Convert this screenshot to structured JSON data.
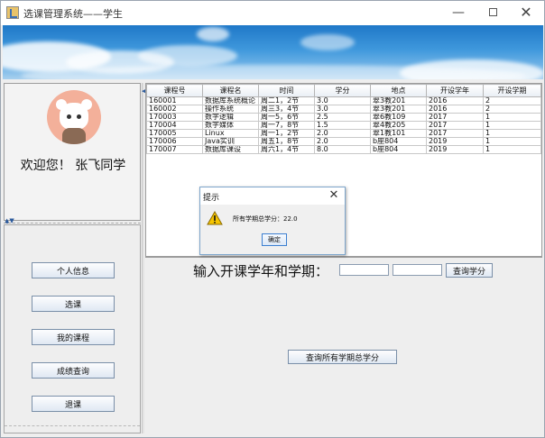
{
  "window": {
    "title": "选课管理系统——学生"
  },
  "user": {
    "welcome": "欢迎您！ 张飞同学"
  },
  "nav": {
    "items": [
      {
        "label": "个人信息"
      },
      {
        "label": "选课"
      },
      {
        "label": "我的课程"
      },
      {
        "label": "成绩查询"
      },
      {
        "label": "退课"
      }
    ]
  },
  "table": {
    "headers": [
      "课程号",
      "课程名",
      "时间",
      "学分",
      "地点",
      "开设学年",
      "开设学期"
    ],
    "rows": [
      [
        "160001",
        "数据库系统概论",
        "周二1，2节",
        "3.0",
        "翠3教201",
        "2016",
        "2"
      ],
      [
        "160002",
        "操作系统",
        "周三3，4节",
        "3.0",
        "翠3教201",
        "2016",
        "2"
      ],
      [
        "170003",
        "数字逻辑",
        "周一5，6节",
        "2.5",
        "翠6教109",
        "2017",
        "1"
      ],
      [
        "170004",
        "数字媒体",
        "周一7，8节",
        "1.5",
        "翠4教205",
        "2017",
        "1"
      ],
      [
        "170005",
        "Linux",
        "周一1，2节",
        "2.0",
        "翠1教101",
        "2017",
        "1"
      ],
      [
        "170006",
        "Java实训",
        "周五1，8节",
        "2.0",
        "b座804",
        "2019",
        "1"
      ],
      [
        "170007",
        "数据库课设",
        "周六1，4节",
        "8.0",
        "b座804",
        "2019",
        "1"
      ]
    ]
  },
  "query": {
    "label": "输入开课学年和学期：",
    "year_value": "",
    "term_value": "",
    "search_label": "查询学分",
    "total_label": "查询所有学期总学分"
  },
  "dialog": {
    "title": "提示",
    "message": "所有学期总学分：22.0",
    "ok_label": "确定"
  },
  "icons": {
    "warning": "warning-icon",
    "close": "close-icon",
    "minimize": "minimize-icon",
    "maximize": "maximize-icon"
  }
}
